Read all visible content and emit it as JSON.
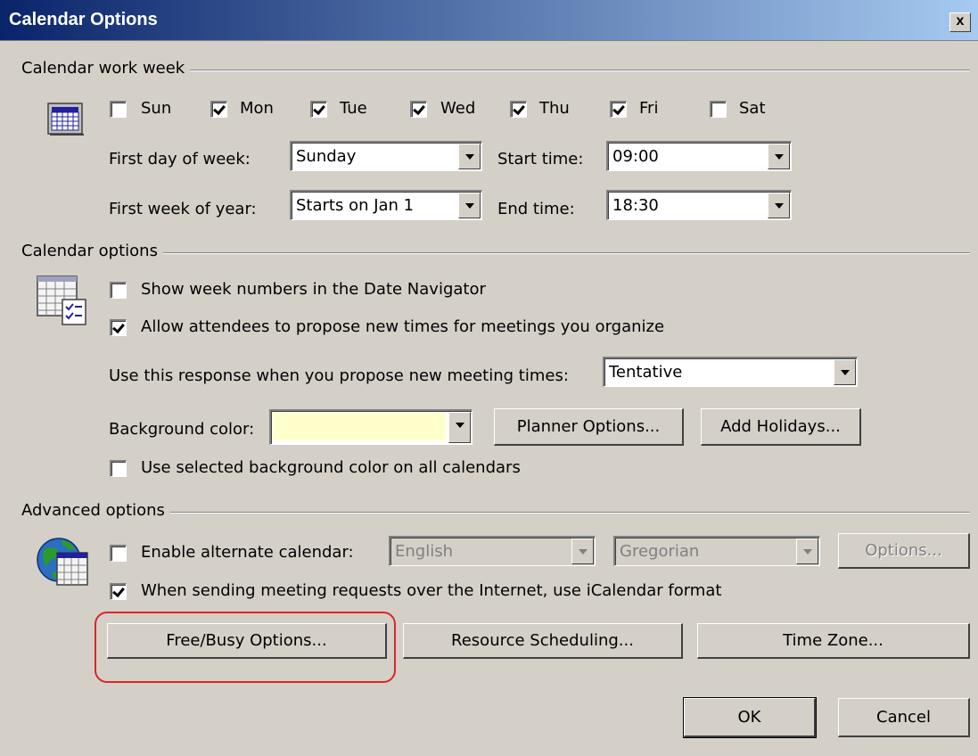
{
  "window": {
    "title": "Calendar Options",
    "close_glyph": "x"
  },
  "work_week": {
    "heading": "Calendar work week",
    "days": [
      {
        "label": "Sun",
        "checked": false
      },
      {
        "label": "Mon",
        "checked": true
      },
      {
        "label": "Tue",
        "checked": true
      },
      {
        "label": "Wed",
        "checked": true
      },
      {
        "label": "Thu",
        "checked": true
      },
      {
        "label": "Fri",
        "checked": true
      },
      {
        "label": "Sat",
        "checked": false
      }
    ],
    "first_day_label": "First day of week:",
    "first_day_value": "Sunday",
    "first_week_label": "First week of year:",
    "first_week_value": "Starts on Jan 1",
    "start_time_label": "Start time:",
    "start_time_value": "09:00",
    "end_time_label": "End time:",
    "end_time_value": "18:30"
  },
  "calendar_options": {
    "heading": "Calendar options",
    "week_numbers_label": "Show week numbers in the Date Navigator",
    "week_numbers_checked": false,
    "allow_propose_label": "Allow attendees to propose new times for meetings you organize",
    "allow_propose_checked": true,
    "response_label": "Use this response when you propose new meeting times:",
    "response_value": "Tentative",
    "bg_color_label": "Background color:",
    "bg_color_value": "#ffffcc",
    "planner_button": "Planner Options...",
    "holidays_button": "Add Holidays...",
    "use_bg_all_label": "Use selected background color on all calendars",
    "use_bg_all_checked": false
  },
  "advanced": {
    "heading": "Advanced options",
    "alt_calendar_label": "Enable alternate calendar:",
    "alt_calendar_checked": false,
    "language_value": "English",
    "calendar_type_value": "Gregorian",
    "options_button": "Options...",
    "icalendar_label": "When sending meeting requests over the Internet, use iCalendar format",
    "icalendar_checked": true,
    "freebusy_button": "Free/Busy Options...",
    "resource_button": "Resource Scheduling...",
    "timezone_button": "Time Zone..."
  },
  "footer": {
    "ok_button": "OK",
    "cancel_button": "Cancel"
  },
  "colors": {
    "highlight_ring": "#d9262a",
    "dialog_bg": "#d4d0c8",
    "title_bar": "#0a246a"
  }
}
